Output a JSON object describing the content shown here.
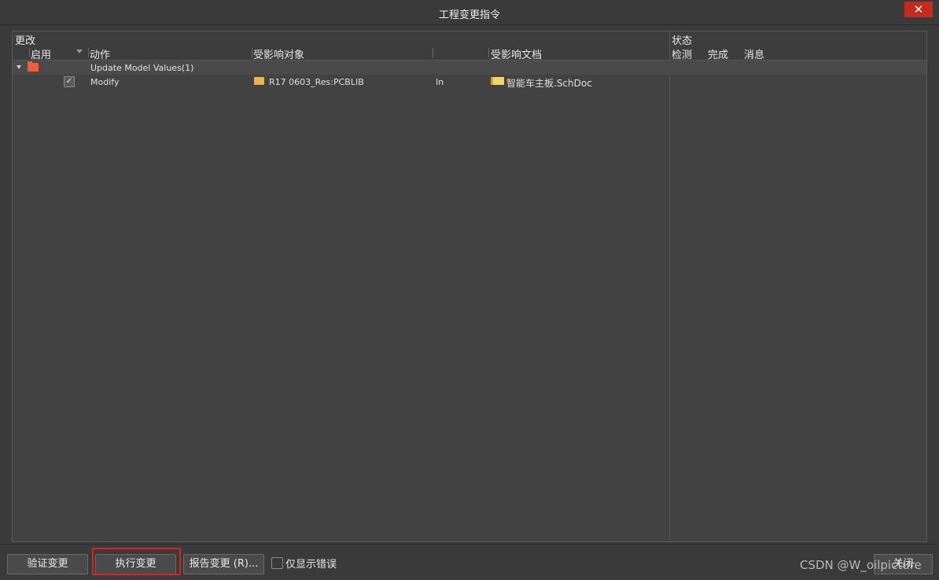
{
  "window": {
    "title": "工程变更指令",
    "close_glyph": "✕"
  },
  "grid": {
    "group_header_left": "更改",
    "group_header_right": "状态",
    "columns": {
      "enable": "启用",
      "action": "动作",
      "affected_object": "受影响对象",
      "affected_document": "受影响文档",
      "check": "检测",
      "done": "完成",
      "message": "消息"
    },
    "group_row": {
      "action": "Update Model Values(1)"
    },
    "rows": [
      {
        "enabled": "✓",
        "action": "Modify",
        "object": "R17 0603_Res:PCBLIB",
        "relation": "In",
        "document": "智能车主板.SchDoc",
        "check": "",
        "done": "",
        "message": ""
      }
    ]
  },
  "footer": {
    "validate_label": "验证变更",
    "execute_label": "执行变更",
    "report_label": "报告变更 (R)...",
    "only_errors_label": "仅显示错误",
    "only_errors_checked": false,
    "close_label": "关闭",
    "watermark": "CSDN @W_oilpicture"
  },
  "icons": {
    "group_folder": "folder-red-icon",
    "object_folder": "folder-icon",
    "document": "schematic-doc-icon"
  },
  "colors": {
    "background": "#3a3a3a",
    "grid_bg": "#424242",
    "close_button": "#c42b1c",
    "highlight": "#e02020"
  }
}
